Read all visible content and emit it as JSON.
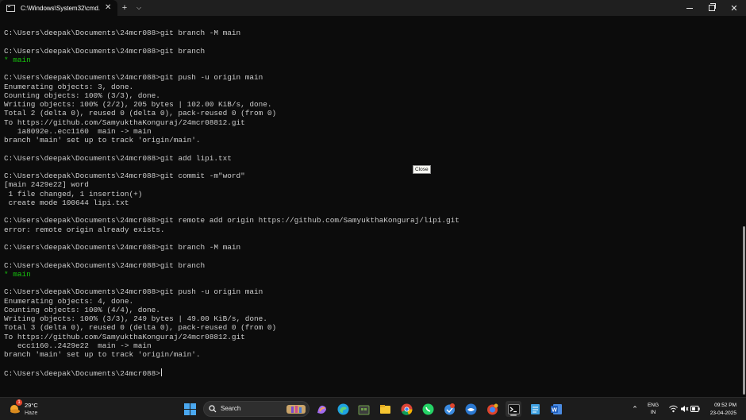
{
  "window": {
    "tab_title": "C:\\Windows\\System32\\cmd.e",
    "colors": {
      "terminal_bg": "#0c0c0c",
      "text": "#cccccc",
      "branch_green": "#16c60c",
      "titlebar": "#1f1f1f"
    }
  },
  "terminal": {
    "lines": [
      "C:\\Users\\deepak\\Documents\\24mcr088>git branch -M main",
      "",
      "C:\\Users\\deepak\\Documents\\24mcr088>git branch",
      "* main",
      "",
      "C:\\Users\\deepak\\Documents\\24mcr088>git push -u origin main",
      "Enumerating objects: 3, done.",
      "Counting objects: 100% (3/3), done.",
      "Writing objects: 100% (2/2), 205 bytes | 102.00 KiB/s, done.",
      "Total 2 (delta 0), reused 0 (delta 0), pack-reused 0 (from 0)",
      "To https://github.com/SamyukthaKonguraj/24mcr08812.git",
      "   1a8092e..ecc1160  main -> main",
      "branch 'main' set up to track 'origin/main'.",
      "",
      "C:\\Users\\deepak\\Documents\\24mcr088>git add lipi.txt",
      "",
      "C:\\Users\\deepak\\Documents\\24mcr088>git commit -m\"word\"",
      "[main 2429e22] word",
      " 1 file changed, 1 insertion(+)",
      " create mode 100644 lipi.txt",
      "",
      "C:\\Users\\deepak\\Documents\\24mcr088>git remote add origin https://github.com/SamyukthaKonguraj/lipi.git",
      "error: remote origin already exists.",
      "",
      "C:\\Users\\deepak\\Documents\\24mcr088>git branch -M main",
      "",
      "C:\\Users\\deepak\\Documents\\24mcr088>git branch",
      "* main",
      "",
      "C:\\Users\\deepak\\Documents\\24mcr088>git push -u origin main",
      "Enumerating objects: 4, done.",
      "Counting objects: 100% (4/4), done.",
      "Writing objects: 100% (3/3), 249 bytes | 49.00 KiB/s, done.",
      "Total 3 (delta 0), reused 0 (delta 0), pack-reused 0 (from 0)",
      "To https://github.com/SamyukthaKonguraj/24mcr08812.git",
      "   ecc1160..2429e22  main -> main",
      "branch 'main' set up to track 'origin/main'.",
      "",
      "C:\\Users\\deepak\\Documents\\24mcr088>"
    ],
    "tooltip": "Close"
  },
  "taskbar": {
    "weather": {
      "temp": "29°C",
      "condition": "Haze",
      "badge": "1"
    },
    "search_placeholder": "Search",
    "apps": [
      "start-icon",
      "search",
      "copilot-icon",
      "edge-icon",
      "store-icon",
      "file-explorer-icon",
      "chrome-icon",
      "whatsapp-icon",
      "app-icon-1",
      "app-icon-2",
      "app-icon-3",
      "terminal-icon",
      "notepad-icon",
      "word-icon"
    ],
    "tray": {
      "language": "ENG",
      "region": "IN",
      "time": "09:52 PM",
      "date": "23-04-2025"
    }
  }
}
